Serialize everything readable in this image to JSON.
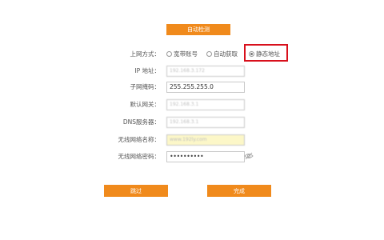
{
  "buttons": {
    "auto_detect": "自动检测",
    "skip": "跳过",
    "done": "完成"
  },
  "internet_mode": {
    "label": "上网方式：",
    "options": [
      "宽带账号",
      "自动获取",
      "静态地址"
    ],
    "selected": "静态地址"
  },
  "fields": {
    "ip": {
      "label": "IP 地址：",
      "value": "192.168.3.172"
    },
    "subnet": {
      "label": "子网掩码：",
      "value": "255.255.255.0"
    },
    "gateway": {
      "label": "默认网关：",
      "value": "192.168.3.1"
    },
    "dns": {
      "label": "DNS服务器：",
      "value": "192.168.3.1"
    },
    "ssid": {
      "label": "无线网络名称：",
      "value": "www.192ly.com"
    },
    "wifi_password": {
      "label": "无线网络密码：",
      "value": "••••••••••"
    }
  },
  "colors": {
    "accent": "#f08a1c",
    "highlight": "#d8101c",
    "ssid_bg": "#fcf7c8"
  },
  "icons": {
    "password_toggle": "eye-slash-icon"
  }
}
